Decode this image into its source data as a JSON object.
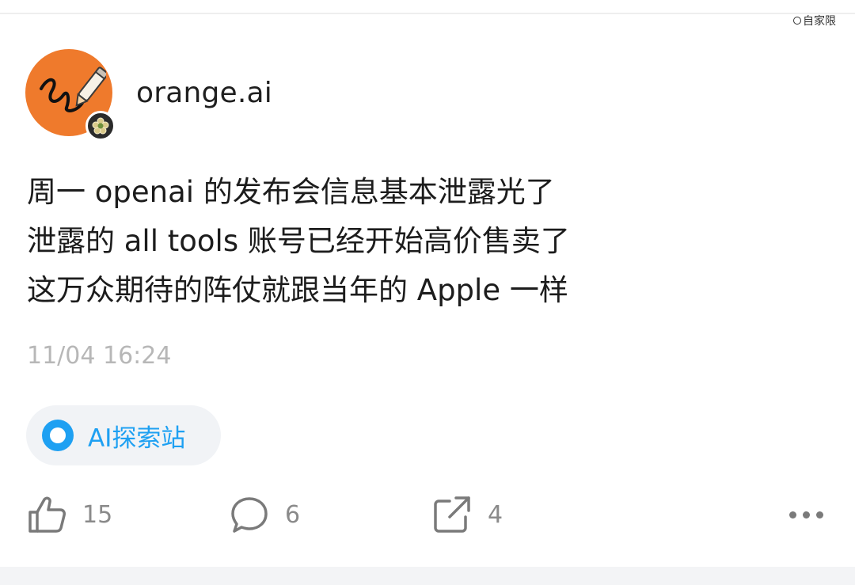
{
  "watermark": {
    "text": "自家限"
  },
  "post": {
    "username": "orange.ai",
    "content_lines": [
      "周一 openai 的发布会信息基本泄露光了",
      "泄露的 all tools 账号已经开始高价售卖了",
      "这万众期待的阵仗就跟当年的 Apple 一样"
    ],
    "timestamp": "11/04 16:24",
    "tag": {
      "label": "AI探索站",
      "icon": "circle-topic-icon"
    },
    "actions": {
      "like_count": "15",
      "comment_count": "6",
      "share_count": "4"
    }
  },
  "colors": {
    "avatar_bg": "#ef7a2c",
    "tag_accent": "#1ea0f2",
    "timestamp": "#b7b7b7",
    "action_icon": "#7a7a7a"
  },
  "icons": {
    "like": "thumbs-up-icon",
    "comment": "speech-bubble-icon",
    "share": "share-arrow-icon",
    "more": "more-dots-icon"
  }
}
